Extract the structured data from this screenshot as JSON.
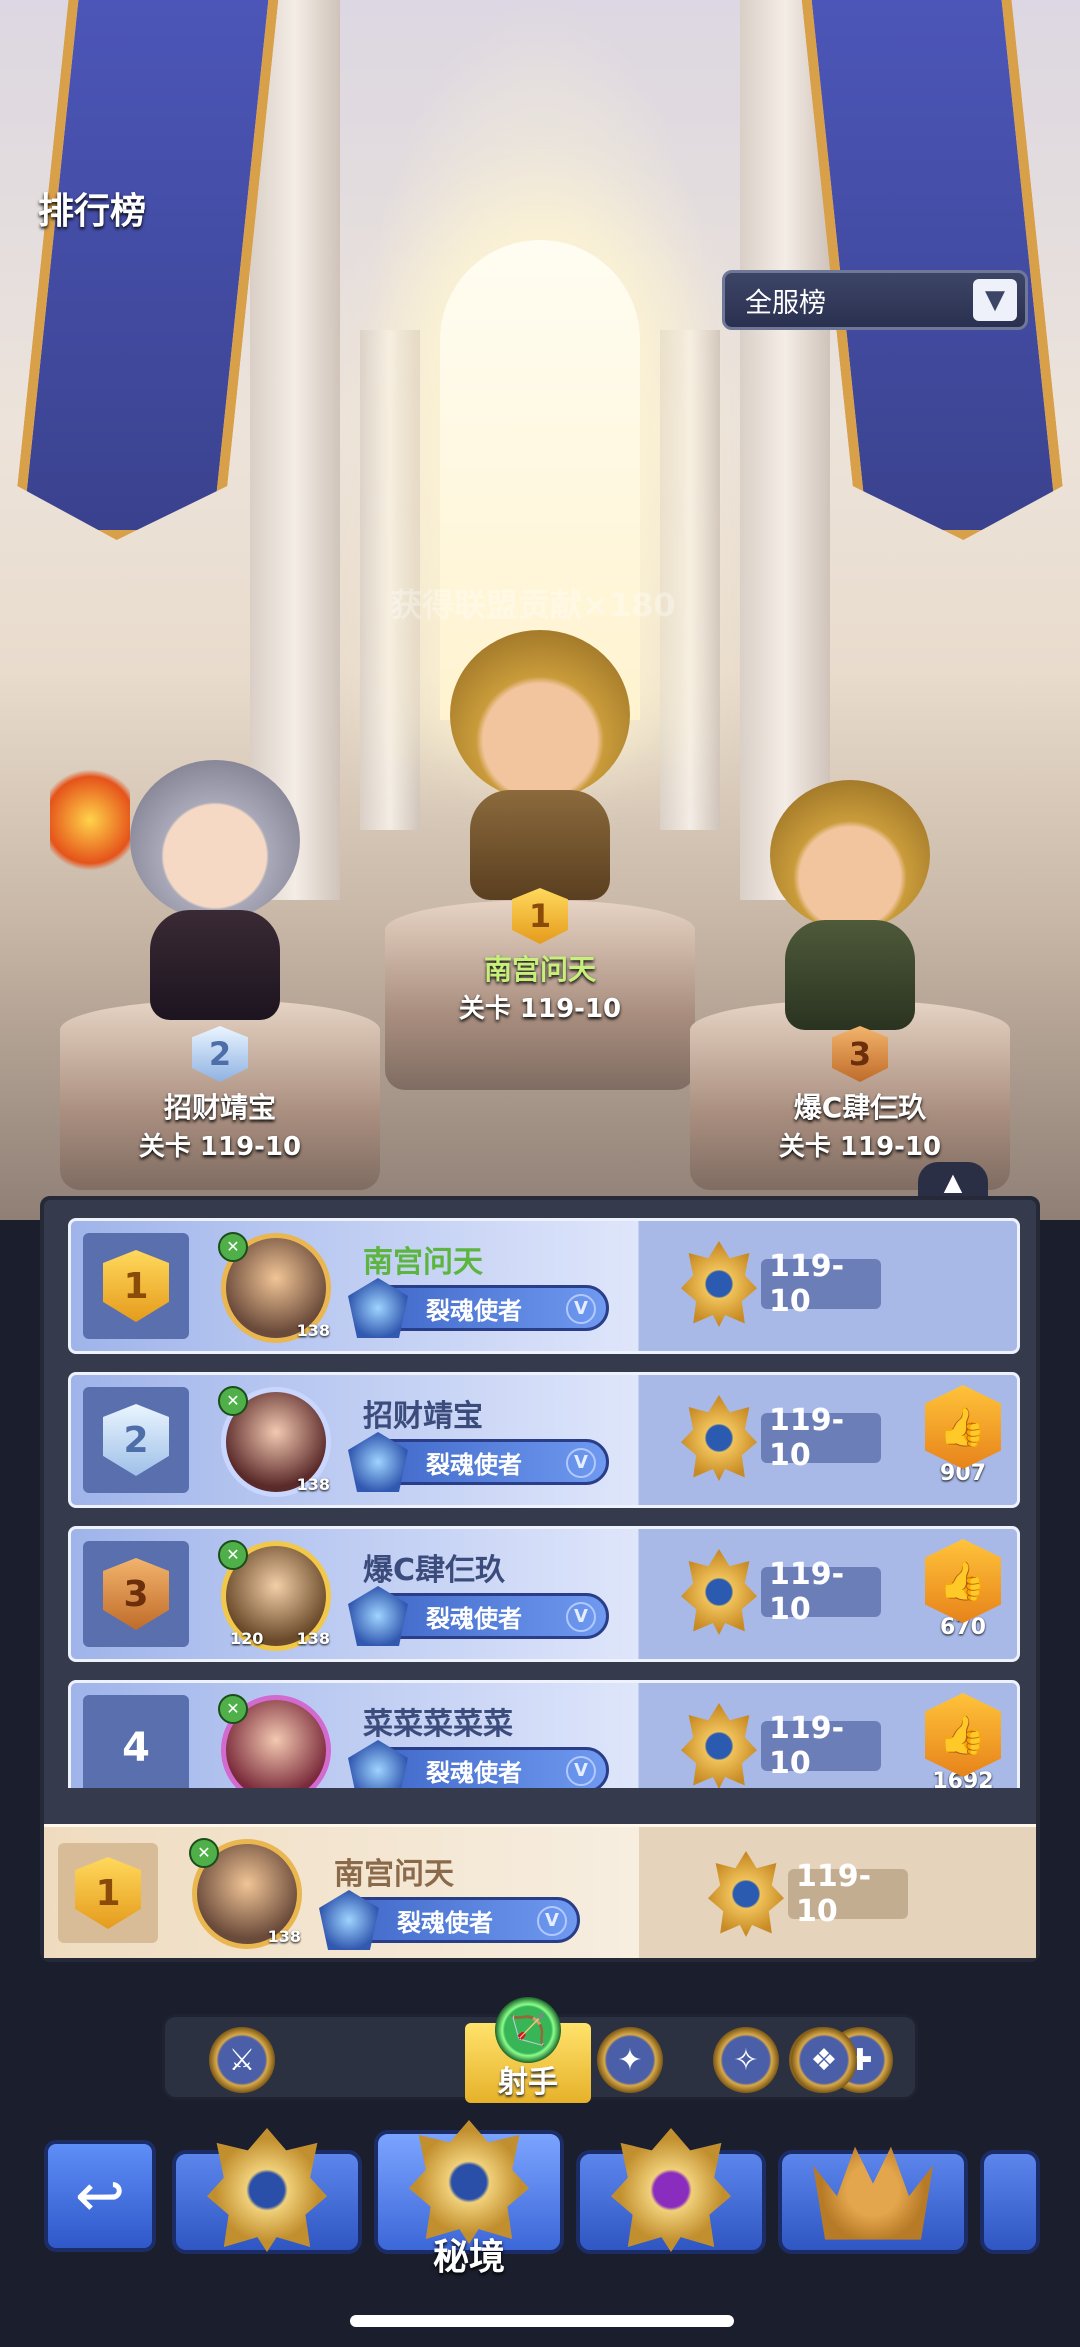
{
  "header": {
    "title": "排行榜",
    "server_filter": {
      "selected": "全服榜",
      "icon": "chevron-down-icon"
    },
    "watermark": "获得联盟贡献×180"
  },
  "podium": [
    {
      "rank": "1",
      "name": "南宫问天",
      "stage": "关卡 119-10"
    },
    {
      "rank": "2",
      "name": "招财靖宝",
      "stage": "关卡 119-10"
    },
    {
      "rank": "3",
      "name": "爆C肆仨玖",
      "stage": "关卡 119-10"
    }
  ],
  "list": {
    "rows": [
      {
        "rank": "1",
        "name": "南宫问天",
        "level": "138",
        "title": "裂魂使者",
        "tier": "V",
        "stage": "119-10",
        "likes": ""
      },
      {
        "rank": "2",
        "name": "招财靖宝",
        "level": "138",
        "title": "裂魂使者",
        "tier": "V",
        "stage": "119-10",
        "likes": "907"
      },
      {
        "rank": "3",
        "name": "爆C肆仨玖",
        "level": "138",
        "level2": "120",
        "title": "裂魂使者",
        "tier": "V",
        "stage": "119-10",
        "likes": "670"
      },
      {
        "rank": "4",
        "name": "菜菜菜菜菜",
        "level": "",
        "title": "裂魂使者",
        "tier": "V",
        "stage": "119-10",
        "likes": "1692"
      }
    ]
  },
  "my_rank": {
    "rank": "1",
    "name": "南宫问天",
    "level": "138",
    "title": "裂魂使者",
    "tier": "V",
    "stage": "119-10"
  },
  "class_filter": {
    "items": [
      "warrior-icon",
      "archer-icon",
      "mage-icon",
      "assassin-icon",
      "priest-icon",
      "summoner-icon"
    ],
    "selected_label": "射手"
  },
  "bottom_nav": {
    "back_icon": "return-arrow-icon",
    "active_label": "秘境"
  },
  "colors": {
    "accent_gold": "#e59b1c",
    "panel": "#353a4c",
    "row_blue": "#a8b9e8"
  }
}
